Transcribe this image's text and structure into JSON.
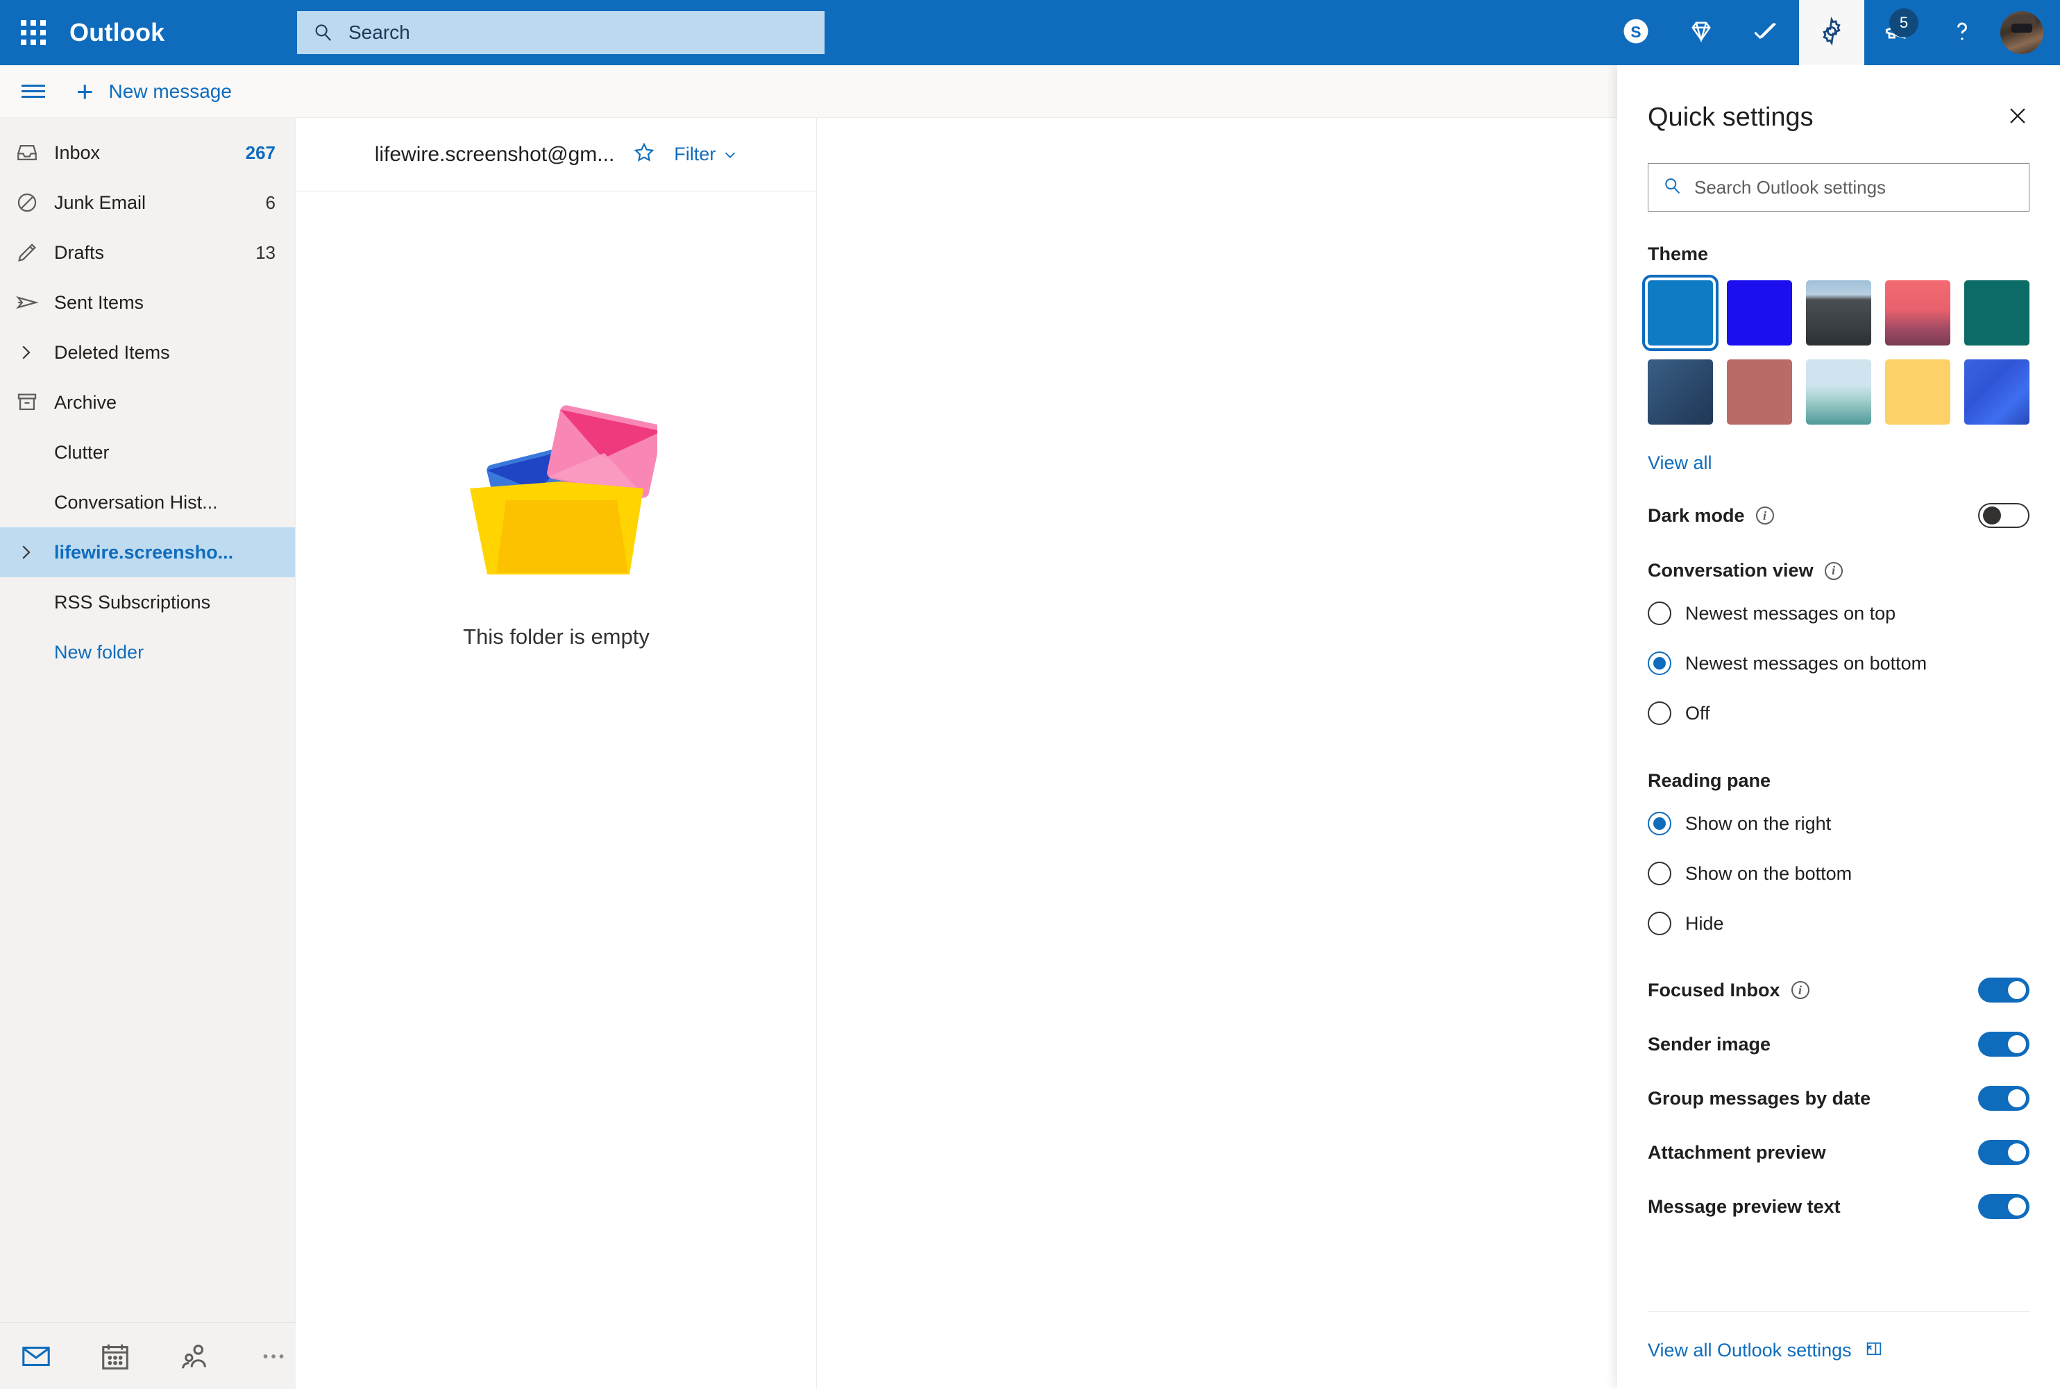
{
  "app": {
    "brand": "Outlook",
    "accent": "#0f6cbd",
    "header_bg": "#0f6cbd",
    "search_bg": "#bdd9ef",
    "sidebar_bg": "#f3f2f1",
    "selected_bg": "#bfdbf0"
  },
  "topbar": {
    "waffle_name": "app-launcher",
    "search": {
      "placeholder": "Search",
      "value": ""
    },
    "actions": [
      {
        "name": "skype-icon",
        "label": "Skype"
      },
      {
        "name": "diamond-icon",
        "label": "Premium"
      },
      {
        "name": "todo-check-icon",
        "label": "To Do"
      },
      {
        "name": "gear-icon",
        "label": "Settings",
        "active": true
      },
      {
        "name": "megaphone-icon",
        "label": "What's new",
        "badge": "5"
      },
      {
        "name": "help-icon",
        "label": "Help"
      },
      {
        "name": "avatar",
        "label": "Account manager"
      }
    ]
  },
  "command_bar": {
    "menu_label": "Toggle navigation pane",
    "new_message": "New message",
    "plus": "+"
  },
  "sidebar": {
    "items": [
      {
        "label": "Inbox",
        "count": "267",
        "icon": "inbox-icon",
        "unread": true,
        "selected": false,
        "link": false
      },
      {
        "label": "Junk Email",
        "count": "6",
        "icon": "block-icon",
        "unread": false,
        "selected": false,
        "link": false
      },
      {
        "label": "Drafts",
        "count": "13",
        "icon": "pencil-icon",
        "unread": false,
        "selected": false,
        "link": false
      },
      {
        "label": "Sent Items",
        "count": "",
        "icon": "send-icon",
        "unread": false,
        "selected": false,
        "link": false
      },
      {
        "label": "Deleted Items",
        "count": "",
        "icon": "chevron-right-icon",
        "unread": false,
        "selected": false,
        "link": false
      },
      {
        "label": "Archive",
        "count": "",
        "icon": "archive-icon",
        "unread": false,
        "selected": false,
        "link": false
      },
      {
        "label": "Clutter",
        "count": "",
        "icon": "",
        "unread": false,
        "selected": false,
        "link": false
      },
      {
        "label": "Conversation Hist...",
        "count": "",
        "icon": "",
        "unread": false,
        "selected": false,
        "link": false
      },
      {
        "label": "lifewire.screensho...",
        "count": "",
        "icon": "chevron-right-icon",
        "unread": false,
        "selected": true,
        "link": false
      },
      {
        "label": "RSS Subscriptions",
        "count": "",
        "icon": "",
        "unread": false,
        "selected": false,
        "link": false
      },
      {
        "label": "New folder",
        "count": "",
        "icon": "",
        "unread": false,
        "selected": false,
        "link": true
      }
    ],
    "app_rail": [
      {
        "name": "mail-icon",
        "label": "Mail",
        "active": true
      },
      {
        "name": "calendar-icon",
        "label": "Calendar",
        "active": false
      },
      {
        "name": "people-icon",
        "label": "People",
        "active": false
      },
      {
        "name": "more-icon",
        "label": "More apps",
        "active": false
      }
    ]
  },
  "message_list": {
    "title": "lifewire.screenshot@gm...",
    "favorite_icon": "star-icon",
    "filter_label": "Filter",
    "filter_chevron": "⌄",
    "empty_text": "This folder is empty"
  },
  "quick_settings": {
    "title": "Quick settings",
    "close_icon": "close-icon",
    "search": {
      "placeholder": "Search Outlook settings",
      "value": "",
      "icon": "search-icon"
    },
    "theme": {
      "heading": "Theme",
      "view_all": "View all",
      "selected_index": 0,
      "swatches": [
        {
          "name": "theme-default-blue",
          "css": "background:#0f7bc4;"
        },
        {
          "name": "theme-pure-blue",
          "css": "background:#1b0ff0;"
        },
        {
          "name": "theme-mountain",
          "css": "background:linear-gradient(180deg,#9fc0d9 0%,#b9d0e0 22%,#4a4f52 30%,#3a3f43 70%,#2c3033 100%);"
        },
        {
          "name": "theme-palm-sunset",
          "css": "background:linear-gradient(180deg,#f36a72 0%,#e8616c 45%,#a04a63 75%,#7a3a53 100%);"
        },
        {
          "name": "theme-circuit-board",
          "css": "background:#0c6b66;"
        },
        {
          "name": "theme-denim-stamp",
          "css": "background:linear-gradient(135deg,#3a5f86 0%,#2c4a6d 50%,#1f3855 100%);"
        },
        {
          "name": "theme-red-lights",
          "css": "background:#b96b68;"
        },
        {
          "name": "theme-sailboat",
          "css": "background:linear-gradient(180deg,#cfe4ee 0%,#cfe4ee 40%,#a8d2cf 60%,#4f9a9b 100%);"
        },
        {
          "name": "theme-gold-star",
          "css": "background:#fcd268;"
        },
        {
          "name": "theme-blue-wave",
          "css": "background:linear-gradient(135deg,#3a63e0 0%,#2f55d6 40%,#3e6ff0 70%,#2749b8 100%);"
        }
      ]
    },
    "dark_mode": {
      "label": "Dark mode",
      "info": true,
      "on": false
    },
    "conversation_view": {
      "label": "Conversation view",
      "info": true,
      "options": [
        {
          "label": "Newest messages on top",
          "checked": false
        },
        {
          "label": "Newest messages on bottom",
          "checked": true
        },
        {
          "label": "Off",
          "checked": false
        }
      ]
    },
    "reading_pane": {
      "label": "Reading pane",
      "info": false,
      "options": [
        {
          "label": "Show on the right",
          "checked": true
        },
        {
          "label": "Show on the bottom",
          "checked": false
        },
        {
          "label": "Hide",
          "checked": false
        }
      ]
    },
    "toggles": [
      {
        "label": "Focused Inbox",
        "info": true,
        "on": true
      },
      {
        "label": "Sender image",
        "info": false,
        "on": true
      },
      {
        "label": "Group messages by date",
        "info": false,
        "on": true
      },
      {
        "label": "Attachment preview",
        "info": false,
        "on": true
      },
      {
        "label": "Message preview text",
        "info": false,
        "on": true
      }
    ],
    "footer": {
      "label": "View all Outlook settings",
      "icon": "open-pane-icon"
    }
  }
}
